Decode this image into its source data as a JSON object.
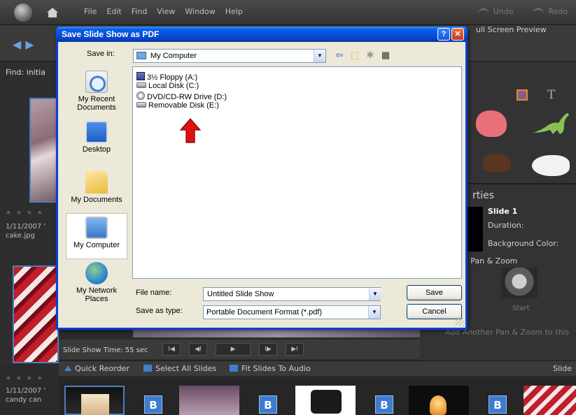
{
  "app": {
    "menu": [
      "File",
      "Edit",
      "Find",
      "View",
      "Window",
      "Help"
    ],
    "undo_label": "Undo",
    "redo_label": "Redo",
    "full_screen_preview_label": "ull Screen Preview",
    "find_label": "Find: initia",
    "thumb_a": {
      "stars": "★ ★ ★ ★",
      "date": "1/11/2007 '",
      "filename": "cake.jpg"
    },
    "properties": {
      "title": "rties",
      "slide_name": "Slide 1",
      "duration_label": "Duration:",
      "background_color_label": "Background Color:",
      "pan_zoom_label": "e Pan & Zoom",
      "start_label": "Start",
      "add_pan_zoom_label": "Add Another Pan & Zoom to this"
    },
    "transport": {
      "slide_show_time": "Slide Show Time: 55 sec",
      "buttons": [
        "I◀",
        "◀I",
        "▶",
        "I▶",
        "▶I"
      ]
    },
    "actions": {
      "quick_reorder": "Quick Reorder",
      "select_all_slides": "Select All Slides",
      "fit_slides_to_audio": "Fit Slides To Audio",
      "slide_right": "Slide"
    },
    "bottom_thumb": {
      "stars": "★ ★ ★ ★",
      "date": "1/11/2007 '",
      "filename": "candy can"
    },
    "film_badge": "B"
  },
  "dialog": {
    "title": "Save Slide Show as PDF",
    "help_button": "?",
    "close_button": "✕",
    "save_in_label": "Save in:",
    "save_in_value": "My Computer",
    "places": [
      {
        "label": "My Recent Documents",
        "icon": "recent-documents-icon"
      },
      {
        "label": "Desktop",
        "icon": "desktop-icon"
      },
      {
        "label": "My Documents",
        "icon": "my-documents-icon"
      },
      {
        "label": "My Computer",
        "icon": "my-computer-icon",
        "selected": true
      },
      {
        "label": "My Network Places",
        "icon": "network-places-icon"
      }
    ],
    "files": [
      {
        "name": "3½ Floppy (A:)",
        "icon": "floppy-icon"
      },
      {
        "name": "Local Disk (C:)",
        "icon": "drive-icon"
      },
      {
        "name": "DVD/CD-RW Drive (D:)",
        "icon": "dvd-icon"
      },
      {
        "name": "Removable Disk (E:)",
        "icon": "drive-icon"
      }
    ],
    "file_name_label": "File name:",
    "file_name_value": "Untitled Slide Show",
    "save_as_type_label": "Save as type:",
    "save_as_type_value": "Portable Document Format (*.pdf)",
    "save_button": "Save",
    "cancel_button": "Cancel"
  },
  "colors": {
    "title_bar": "#0a5fe8",
    "dialog_bg": "#ece9d8",
    "annotation_arrow": "#e01010"
  }
}
